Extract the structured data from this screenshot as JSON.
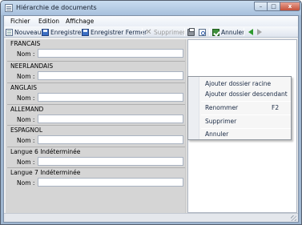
{
  "window": {
    "title": "Hiérarchie de documents",
    "minimize_glyph": "–",
    "maximize_glyph": "□",
    "close_glyph": "x"
  },
  "menubar": {
    "items": [
      "Fichier",
      "Edition",
      "Affichage"
    ]
  },
  "toolbar": {
    "nouveau": "Nouveau",
    "enregistrer": "Enregistrer",
    "enregistrer_fermer": "Enregistrer Fermer",
    "supprimer": "Supprimer",
    "annuler": "Annuler",
    "icons": [
      "new-document-icon",
      "save-icon",
      "save-close-icon",
      "delete-icon",
      "print-icon",
      "print-preview-icon",
      "cancel-check-icon",
      "back-arrow-icon",
      "forward-arrow-icon"
    ]
  },
  "languages": [
    {
      "name": "FRANCAIS",
      "field_label": "Nom :",
      "value": ""
    },
    {
      "name": "NEERLANDAIS",
      "field_label": "Nom :",
      "value": ""
    },
    {
      "name": "ANGLAIS",
      "field_label": "Nom :",
      "value": ""
    },
    {
      "name": "ALLEMAND",
      "field_label": "Nom :",
      "value": ""
    },
    {
      "name": "ESPAGNOL",
      "field_label": "Nom :",
      "value": ""
    },
    {
      "name": "Langue 6 Indéterminée",
      "field_label": "Nom :",
      "value": ""
    },
    {
      "name": "Langue 7 Indéterminée",
      "field_label": "Nom :",
      "value": ""
    }
  ],
  "context_menu": {
    "ajouter_racine": "Ajouter dossier racine",
    "ajouter_descendant": "Ajouter dossier descendant",
    "renommer": "Renommer",
    "renommer_shortcut": "F2",
    "supprimer": "Supprimer",
    "annuler": "Annuler"
  },
  "colors": {
    "window_frame": "#9fb6d0",
    "left_panel": "#d5d5d5",
    "back_arrow": "#2e9a2e",
    "forward_arrow_disabled": "#a6a6a6"
  }
}
